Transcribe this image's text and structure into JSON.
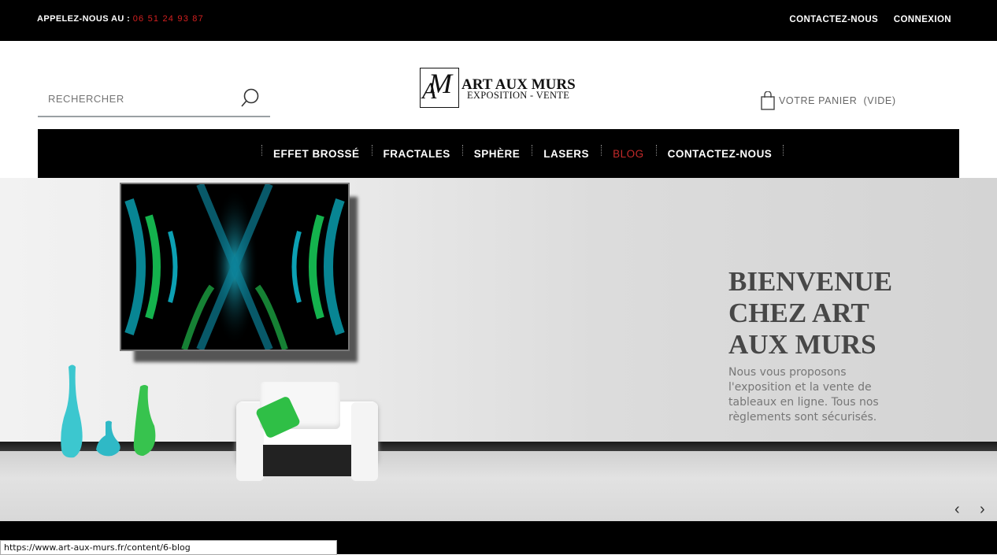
{
  "topbar": {
    "phone_label": "APPELEZ-NOUS AU :",
    "phone_number": "06 51 24 93 87",
    "contact_link": "CONTACTEZ-NOUS",
    "login_link": "CONNEXION"
  },
  "search": {
    "placeholder": "RECHERCHER",
    "icon": "search-icon"
  },
  "logo": {
    "mark": "AM",
    "title": "ART AUX MURS",
    "subtitle": "EXPOSITION - VENTE"
  },
  "cart": {
    "label": "VOTRE PANIER",
    "status": "(VIDE)",
    "icon": "shopping-bag-icon"
  },
  "nav": {
    "items": [
      {
        "label": "EFFET BROSSÉ"
      },
      {
        "label": "FRACTALES"
      },
      {
        "label": "SPHÈRE"
      },
      {
        "label": "LASERS"
      },
      {
        "label": "BLOG",
        "active": true
      },
      {
        "label": "CONTACTEZ-NOUS"
      }
    ],
    "active_color": "#c52a2a"
  },
  "hero": {
    "title": "BIENVENUE CHEZ ART AUX MURS",
    "description": "Nous vous proposons l'exposition et la vente de tableaux en ligne. Tous nos règlements sont sécurisés.",
    "prev": "‹",
    "next": "›"
  },
  "status_bar": {
    "url": "https://www.art-aux-murs.fr/content/6-blog"
  },
  "colors": {
    "accent_red": "#d42020",
    "nav_bg": "#000000"
  }
}
